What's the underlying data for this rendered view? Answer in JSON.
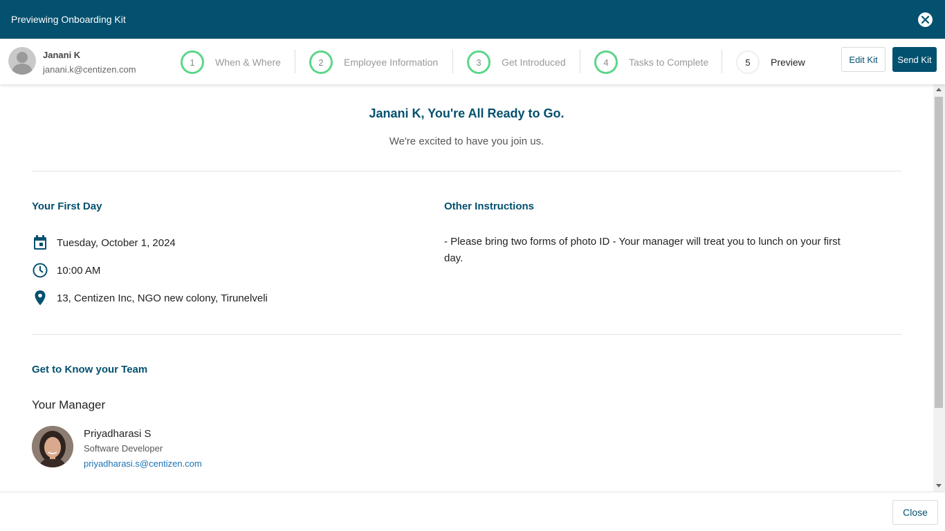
{
  "window": {
    "title": "Previewing Onboarding Kit",
    "close_icon": "close-circle-icon"
  },
  "user": {
    "name": "Janani K",
    "email": "janani.k@centizen.com",
    "avatar_icon": "user-placeholder-icon"
  },
  "steps": [
    {
      "number": "1",
      "label": "When & Where",
      "state": "completed"
    },
    {
      "number": "2",
      "label": "Employee Information",
      "state": "completed"
    },
    {
      "number": "3",
      "label": "Get Introduced",
      "state": "completed"
    },
    {
      "number": "4",
      "label": "Tasks to Complete",
      "state": "completed"
    },
    {
      "number": "5",
      "label": "Preview",
      "state": "active"
    }
  ],
  "actions": {
    "edit_label": "Edit Kit",
    "send_label": "Send Kit"
  },
  "preview": {
    "headline": "Janani K, You're All Ready to Go.",
    "subline": "We're excited to have you join us.",
    "first_day": {
      "title": "Your First Day",
      "date": "Tuesday, October 1, 2024",
      "time": "10:00 AM",
      "location": "13, Centizen Inc, NGO new colony, Tirunelveli"
    },
    "instructions": {
      "title": "Other Instructions",
      "text": "- Please bring two forms of photo ID - Your manager will treat you to lunch on your first day."
    },
    "team": {
      "title": "Get to Know your Team",
      "manager_heading": "Your Manager",
      "manager": {
        "name": "Priyadharasi S",
        "role": "Software Developer",
        "email": "priyadharasi.s@centizen.com"
      }
    }
  },
  "footer": {
    "close_label": "Close"
  },
  "colors": {
    "brand": "#03506f",
    "step_complete": "#5cd58a",
    "link": "#1a73b5"
  }
}
